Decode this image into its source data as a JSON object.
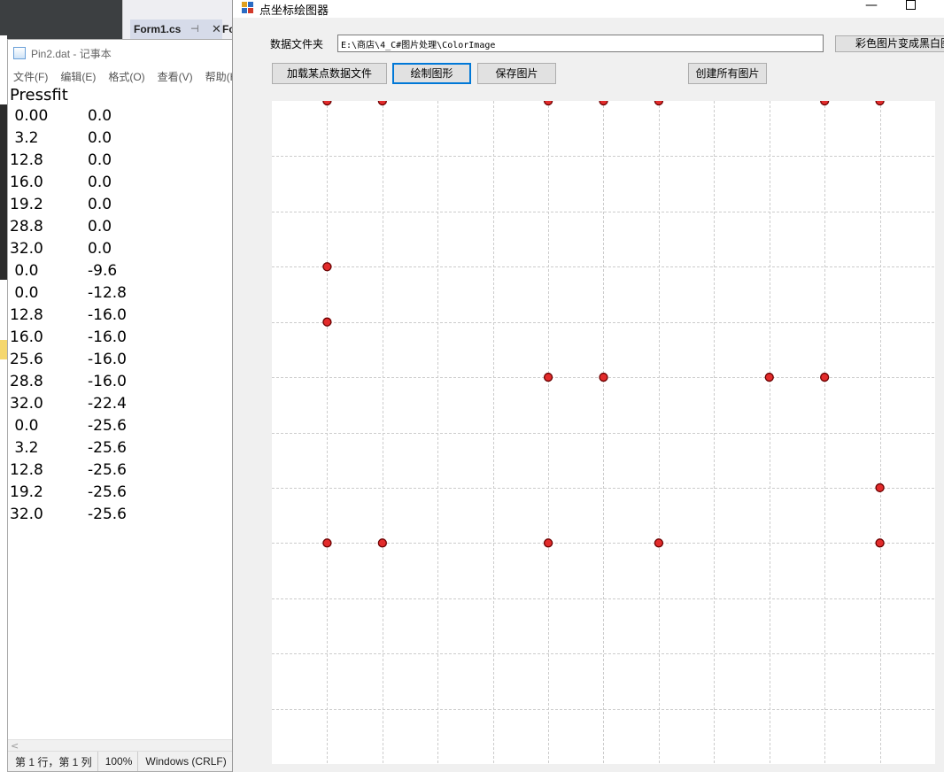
{
  "ide": {
    "tab_label": "Form1.cs",
    "tab_pin": "⊣",
    "tab_close": "✕",
    "next_tab_label": "Fo"
  },
  "notepad": {
    "title": "Pin2.dat - 记事本",
    "menu": [
      "文件(F)",
      "编辑(E)",
      "格式(O)",
      "查看(V)",
      "帮助(H)"
    ],
    "header": "Pressfit",
    "rows": [
      [
        " 0.00",
        "0.0"
      ],
      [
        " 3.2",
        "0.0"
      ],
      [
        "12.8",
        "0.0"
      ],
      [
        "16.0",
        "0.0"
      ],
      [
        "19.2",
        "0.0"
      ],
      [
        "28.8",
        "0.0"
      ],
      [
        "32.0",
        "0.0"
      ],
      [
        " 0.0",
        "-9.6"
      ],
      [
        " 0.0",
        "-12.8"
      ],
      [
        "12.8",
        "-16.0"
      ],
      [
        "16.0",
        "-16.0"
      ],
      [
        "25.6",
        "-16.0"
      ],
      [
        "28.8",
        "-16.0"
      ],
      [
        "32.0",
        "-22.4"
      ],
      [
        " 0.0",
        "-25.6"
      ],
      [
        " 3.2",
        "-25.6"
      ],
      [
        "12.8",
        "-25.6"
      ],
      [
        "19.2",
        "-25.6"
      ],
      [
        "32.0",
        "-25.6"
      ]
    ],
    "status_position": "第 1 行，第 1 列",
    "status_zoom": "100%",
    "status_encoding": "Windows (CRLF)"
  },
  "form": {
    "title": "点坐标绘图器",
    "folder_label": "数据文件夹",
    "folder_path": "E:\\商店\\4_C#图片处理\\ColorImage",
    "buttons": {
      "load": "加载某点数据文件",
      "draw": "绘制图形",
      "save": "保存图片",
      "create_all": "创建所有图片",
      "to_bw": "彩色图片变成黑白图"
    }
  },
  "chart_data": {
    "type": "scatter",
    "grid": true,
    "x_range": [
      -3.2,
      35.2
    ],
    "y_range": [
      -38.4,
      0
    ],
    "marker_fill": "#e22b2b",
    "marker_stroke": "#6b0000",
    "grid_color": "#cccccc",
    "points": [
      {
        "x": 0.0,
        "y": 0.0
      },
      {
        "x": 3.2,
        "y": 0.0
      },
      {
        "x": 12.8,
        "y": 0.0
      },
      {
        "x": 16.0,
        "y": 0.0
      },
      {
        "x": 19.2,
        "y": 0.0
      },
      {
        "x": 28.8,
        "y": 0.0
      },
      {
        "x": 32.0,
        "y": 0.0
      },
      {
        "x": 0.0,
        "y": -9.6
      },
      {
        "x": 0.0,
        "y": -12.8
      },
      {
        "x": 12.8,
        "y": -16.0
      },
      {
        "x": 16.0,
        "y": -16.0
      },
      {
        "x": 25.6,
        "y": -16.0
      },
      {
        "x": 28.8,
        "y": -16.0
      },
      {
        "x": 32.0,
        "y": -22.4
      },
      {
        "x": 0.0,
        "y": -25.6
      },
      {
        "x": 3.2,
        "y": -25.6
      },
      {
        "x": 12.8,
        "y": -25.6
      },
      {
        "x": 19.2,
        "y": -25.6
      },
      {
        "x": 32.0,
        "y": -25.6
      }
    ]
  }
}
